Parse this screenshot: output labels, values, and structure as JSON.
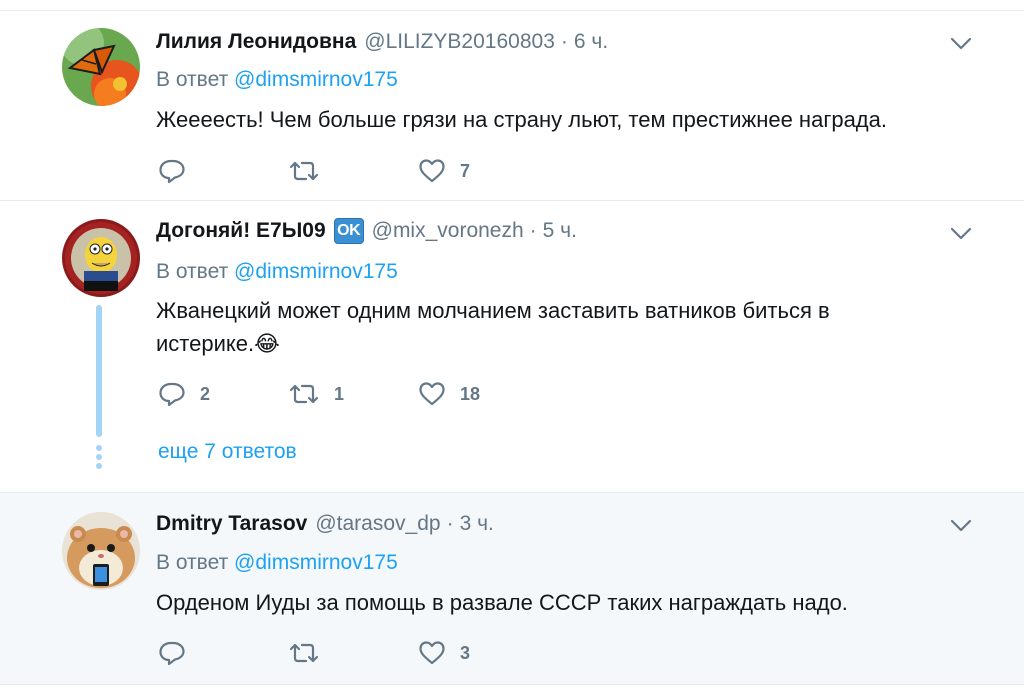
{
  "tweets": [
    {
      "name": "Лилия Леонидовна",
      "handle": "@LILIZYB20160803",
      "separator": "·",
      "time": "6 ч.",
      "reply_prefix": "В ответ",
      "reply_mention": "@dimsmirnov175",
      "text": "Жеееесть! Чем больше грязи на страну льют, тем престижнее награда.",
      "reply_count": "",
      "retweet_count": "",
      "like_count": "7"
    },
    {
      "name": "Догоняй! Е7Ы09",
      "badge": "OK",
      "handle": "@mix_voronezh",
      "separator": "·",
      "time": "5 ч.",
      "reply_prefix": "В ответ",
      "reply_mention": "@dimsmirnov175",
      "text": "Жванецкий может одним молчанием заставить ватников биться в истерике.😂",
      "reply_count": "2",
      "retweet_count": "1",
      "like_count": "18",
      "more_replies": "еще 7 ответов"
    },
    {
      "name": "Dmitry Tarasov",
      "handle": "@tarasov_dp",
      "separator": "·",
      "time": "3 ч.",
      "reply_prefix": "В ответ",
      "reply_mention": "@dimsmirnov175",
      "text": "Орденом Иуды за помощь в развале СССР таких награждать надо.",
      "reply_count": "",
      "retweet_count": "",
      "like_count": "3"
    }
  ],
  "icons": {
    "reply": "reply-icon",
    "retweet": "retweet-icon",
    "like": "like-icon",
    "more": "chevron-down-icon"
  },
  "colors": {
    "accent": "#1da1f2",
    "muted": "#657786",
    "text": "#14171a",
    "thread_line": "#a3d3f5",
    "highlight_bg": "#f5f8fa"
  }
}
